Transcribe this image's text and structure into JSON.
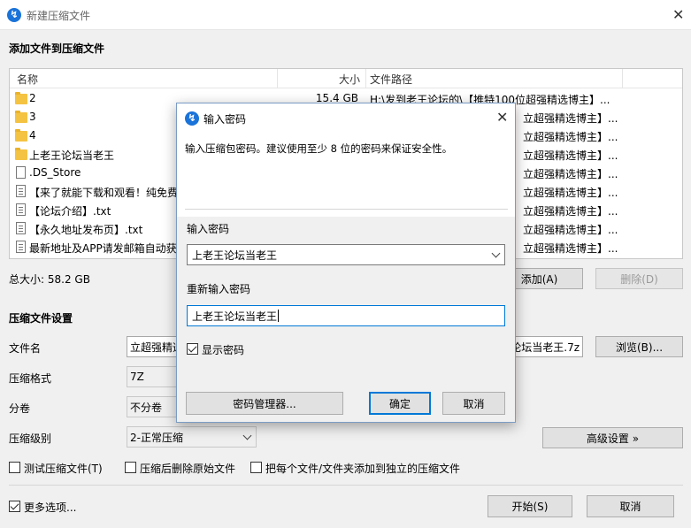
{
  "window": {
    "title": "新建压缩文件",
    "close_glyph": "✕"
  },
  "add_section": {
    "title": "添加文件到压缩文件",
    "columns": {
      "name": "名称",
      "size": "大小",
      "path": "文件路径"
    },
    "rows": [
      {
        "icon": "folder",
        "name": "2",
        "size": "15.4 GB",
        "path": "H:\\发到老王论坛的\\【推特100位超强精选博主】..."
      },
      {
        "icon": "folder",
        "name": "3",
        "size": "",
        "path": "立超强精选博主】..."
      },
      {
        "icon": "folder",
        "name": "4",
        "size": "",
        "path": "立超强精选博主】..."
      },
      {
        "icon": "folder",
        "name": "上老王论坛当老王",
        "size": "",
        "path": "立超强精选博主】..."
      },
      {
        "icon": "file",
        "name": ".DS_Store",
        "size": "",
        "path": "立超强精选博主】..."
      },
      {
        "icon": "doc",
        "name": "【来了就能下载和观看！纯免费",
        "size": "",
        "path": "立超强精选博主】..."
      },
      {
        "icon": "doc",
        "name": "【论坛介绍】.txt",
        "size": "",
        "path": "立超强精选博主】..."
      },
      {
        "icon": "doc",
        "name": "【永久地址发布页】.txt",
        "size": "",
        "path": "立超强精选博主】..."
      },
      {
        "icon": "doc",
        "name": "最新地址及APP请发邮箱自动获",
        "size": "",
        "path": "立超强精选博主】..."
      }
    ],
    "total_size": "总大小: 58.2 GB",
    "add_button": "添加(A)",
    "delete_button": "删除(D)"
  },
  "settings": {
    "title": "压缩文件设置",
    "filename_label": "文件名",
    "filename_value_left": "立超强精选",
    "filename_value_right": "论坛当老王.7z",
    "browse_button": "浏览(B)...",
    "format_label": "压缩格式",
    "format_value": "7Z",
    "split_label": "分卷",
    "split_value": "不分卷",
    "level_label": "压缩级别",
    "level_value": "2-正常压缩",
    "advanced_button": "高级设置 »",
    "test_checkbox": "测试压缩文件(T)",
    "delete_after_checkbox": "压缩后删除原始文件",
    "separate_checkbox": "把每个文件/文件夹添加到独立的压缩文件",
    "more_options_checkbox": "更多选项...",
    "start_button": "开始(S)",
    "cancel_button": "取消"
  },
  "dialog": {
    "title": "输入密码",
    "description": "输入压缩包密码。建议使用至少 8 位的密码来保证安全性。",
    "password_label": "输入密码",
    "password_value": "上老王论坛当老王",
    "confirm_label": "重新输入密码",
    "confirm_value": "上老王论坛当老王",
    "show_password": "显示密码",
    "manager_button": "密码管理器...",
    "ok_button": "确定",
    "cancel_button": "取消"
  },
  "colors": {
    "accent": "#0078d7",
    "app_icon": "#1a73d9",
    "folder": "#f5c342"
  }
}
